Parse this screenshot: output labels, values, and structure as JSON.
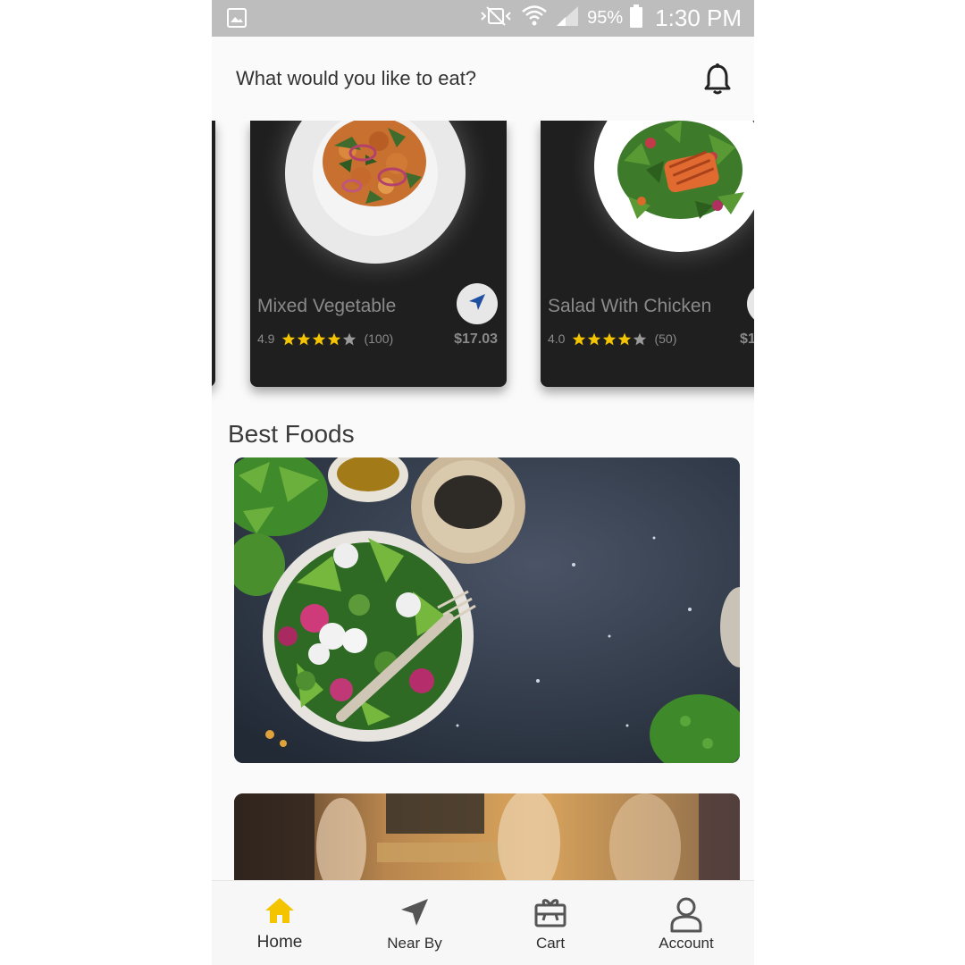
{
  "status_bar": {
    "battery": "95%",
    "time": "1:30 PM",
    "icons": [
      "image-icon",
      "vibrate-off-icon",
      "wifi-icon",
      "signal-icon",
      "battery-icon"
    ]
  },
  "header": {
    "title": "What would you like to eat?",
    "icon": "bell-icon"
  },
  "cards": [
    {
      "name": "Mixed Vegetable",
      "rating": "4.9",
      "stars": 4,
      "reviews": "(100)",
      "price": "$17.03"
    },
    {
      "name": "Salad With Chicken",
      "rating": "4.0",
      "stars": 4,
      "reviews": "(50)",
      "price": "$1"
    }
  ],
  "best_foods": {
    "title": "Best Foods"
  },
  "bottom_nav": {
    "items": [
      {
        "label": "Home",
        "icon": "home-icon",
        "active": true
      },
      {
        "label": "Near By",
        "icon": "navigation-icon",
        "active": false
      },
      {
        "label": "Cart",
        "icon": "cart-gift-icon",
        "active": false
      },
      {
        "label": "Account",
        "icon": "account-icon",
        "active": false
      }
    ]
  },
  "colors": {
    "accent": "#f5c400",
    "card_bg": "#1f1f1f",
    "nav_arrow": "#1e4fa0",
    "status_bar": "#bdbdbd"
  }
}
